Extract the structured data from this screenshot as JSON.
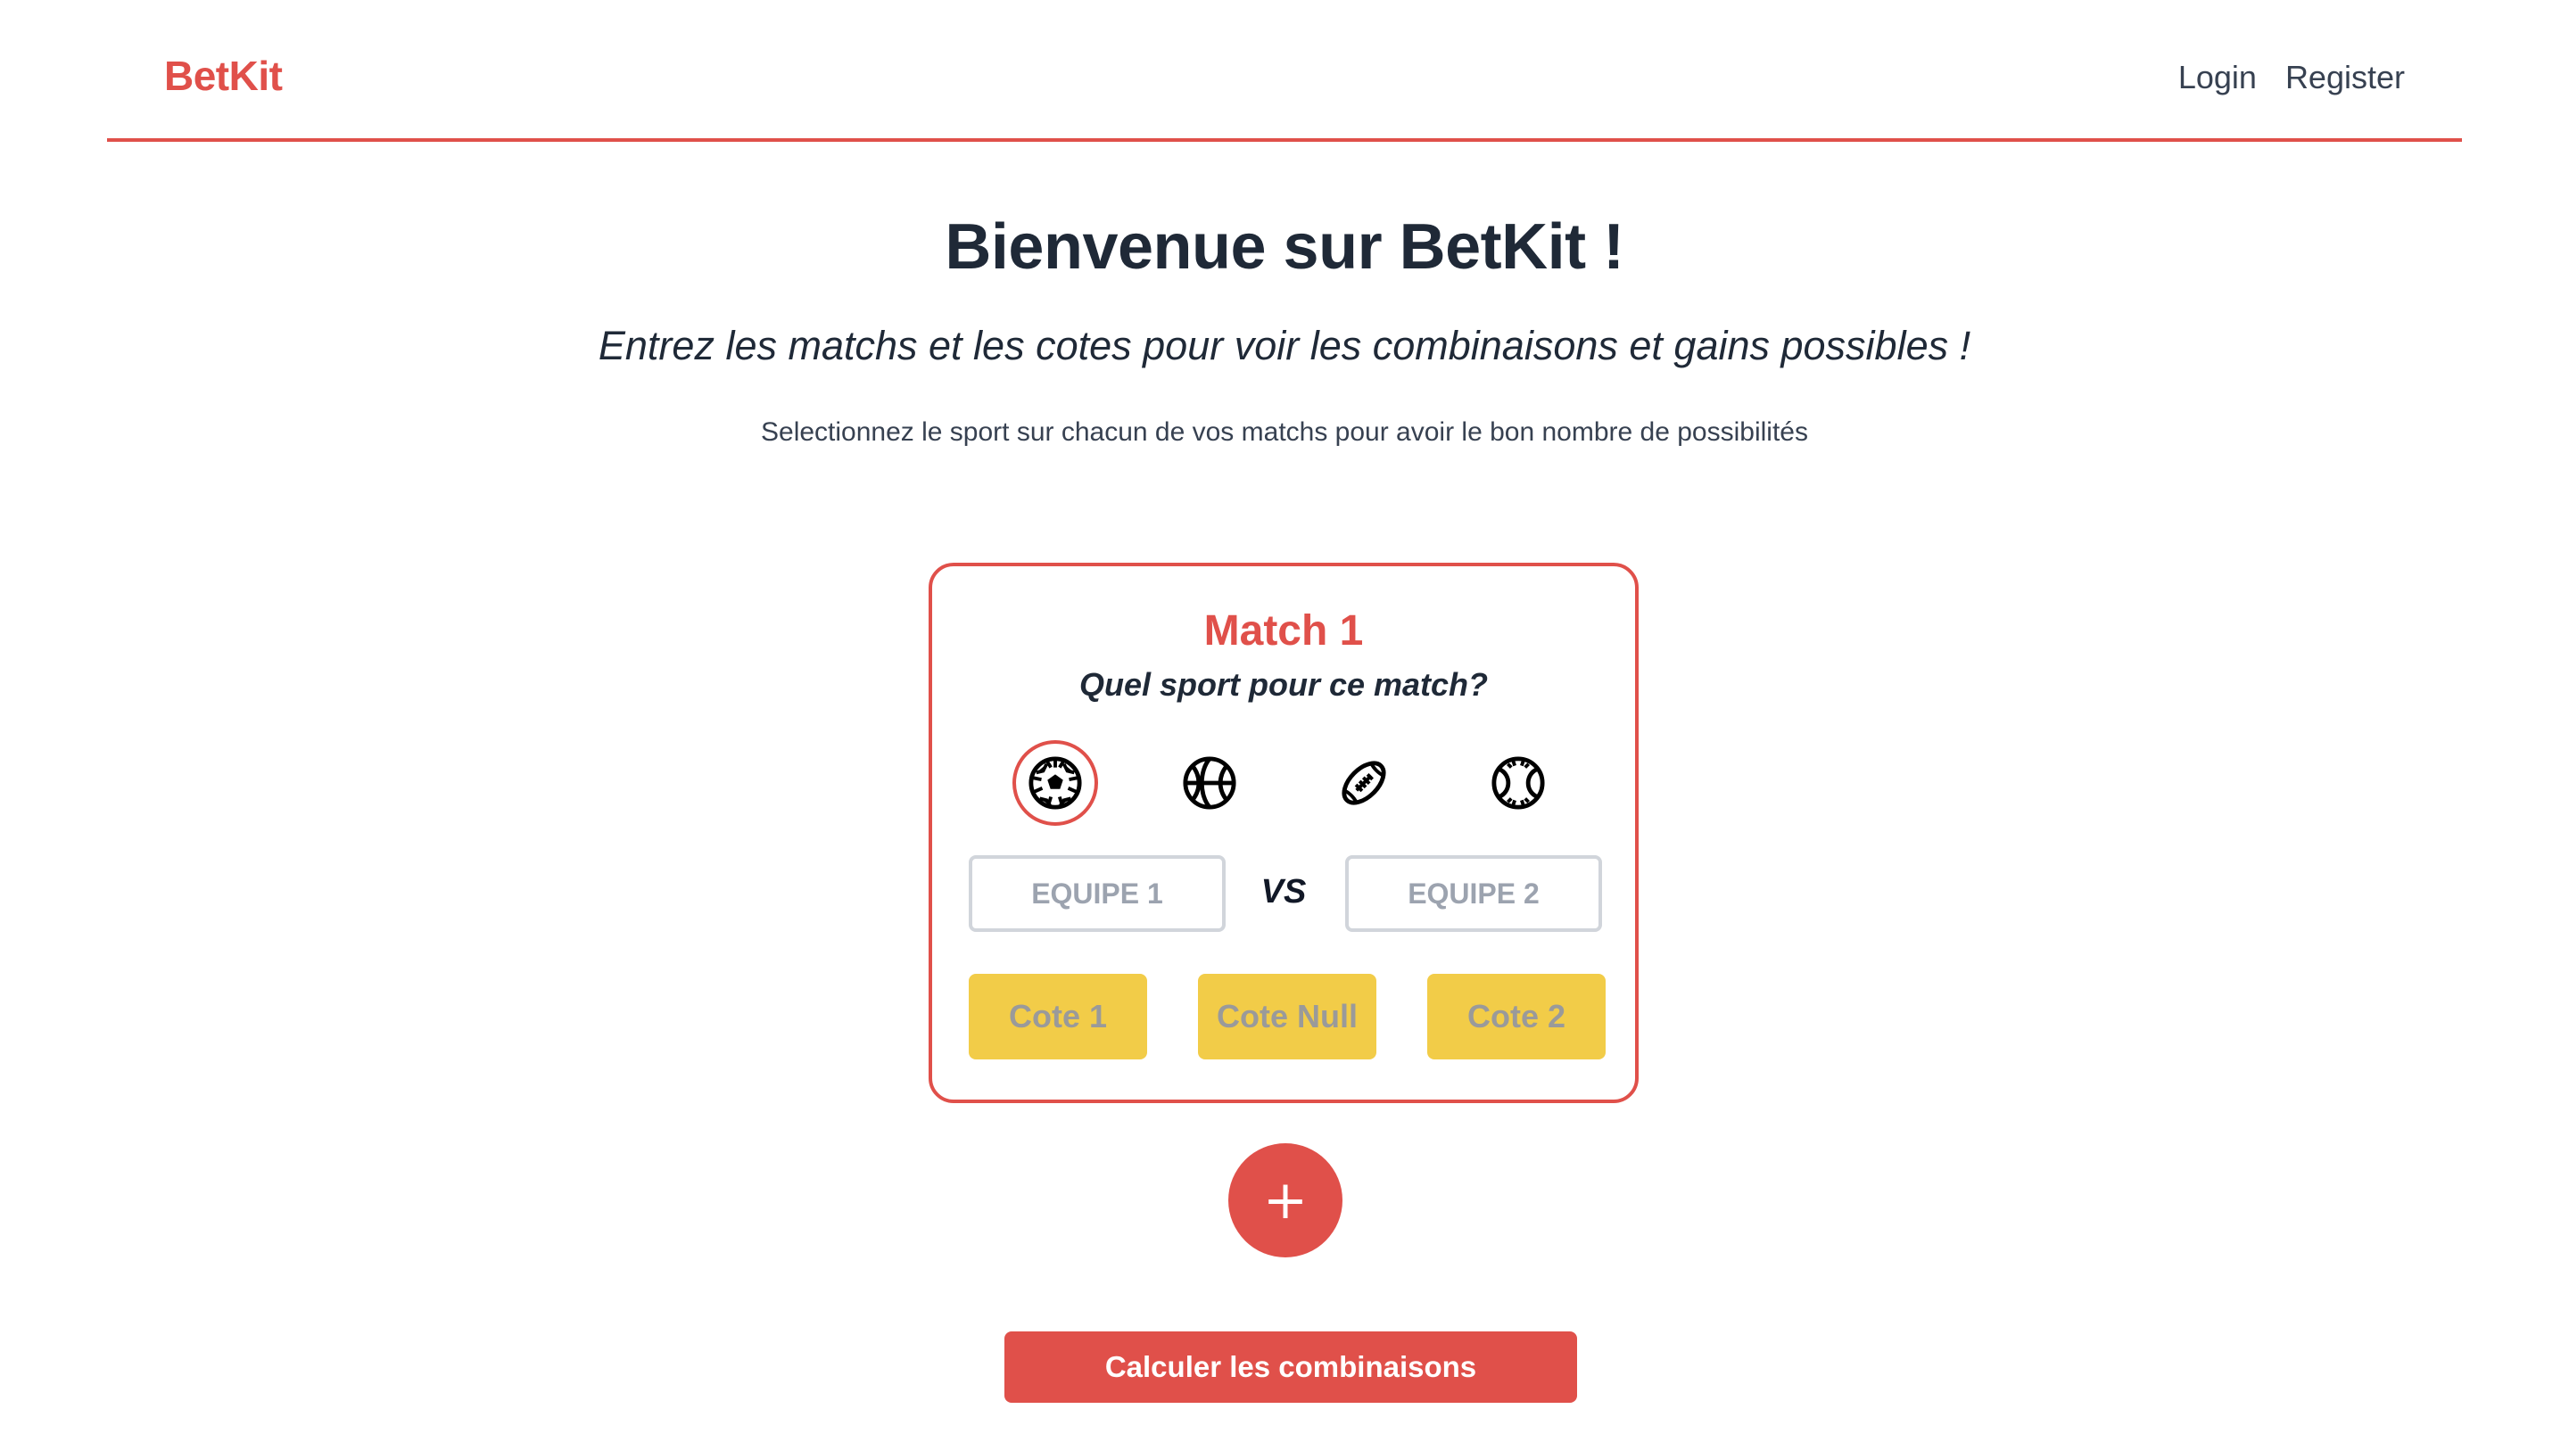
{
  "header": {
    "brand": "BetKit",
    "nav": {
      "login": "Login",
      "register": "Register"
    }
  },
  "hero": {
    "title": "Bienvenue sur BetKit !",
    "subtitle": "Entrez les matchs et les cotes pour voir les combinaisons et gains possibles !",
    "hint": "Selectionnez le sport sur chacun de vos matchs pour avoir le bon nombre de possibilités"
  },
  "match": {
    "title": "Match 1",
    "question": "Quel sport pour ce match?",
    "sports": [
      {
        "icon": "soccer-ball-icon",
        "selected": true
      },
      {
        "icon": "basketball-icon",
        "selected": false
      },
      {
        "icon": "american-football-icon",
        "selected": false
      },
      {
        "icon": "tennis-ball-icon",
        "selected": false
      }
    ],
    "team1": {
      "placeholder": "EQUIPE 1",
      "value": ""
    },
    "vs": "VS",
    "team2": {
      "placeholder": "EQUIPE 2",
      "value": ""
    },
    "odds": {
      "odd1": {
        "placeholder": "Cote 1",
        "value": ""
      },
      "odd_draw": {
        "placeholder": "Cote Null",
        "value": ""
      },
      "odd2": {
        "placeholder": "Cote 2",
        "value": ""
      }
    }
  },
  "actions": {
    "add_match": "+",
    "calculate": "Calculer les combinaisons"
  },
  "colors": {
    "accent": "#e0504a",
    "odds_background": "#f2cc48",
    "text_dark": "#1f2937",
    "input_border": "#d1d5db"
  }
}
